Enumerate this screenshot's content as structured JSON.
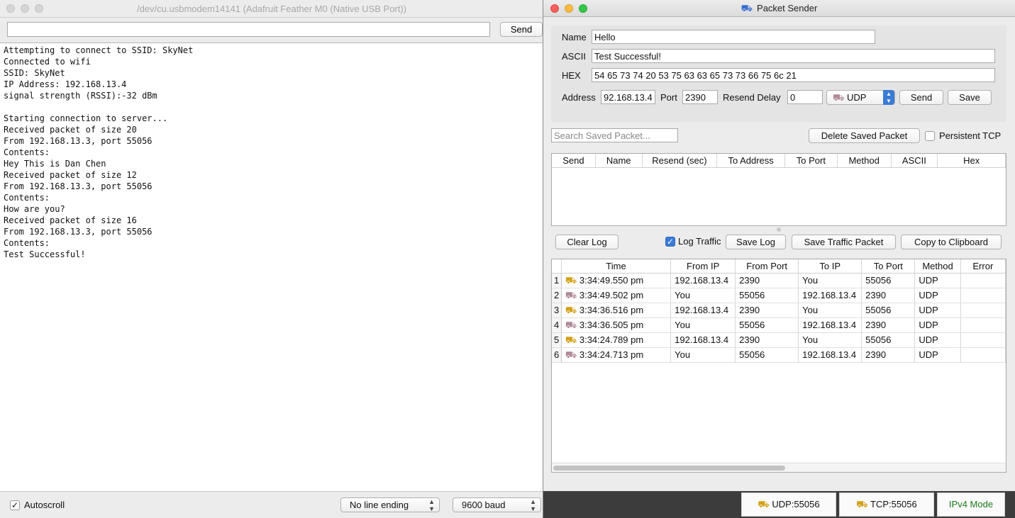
{
  "serial_monitor": {
    "title": "/dev/cu.usbmodem14141 (Adafruit Feather M0 (Native USB Port))",
    "input_value": "",
    "send_label": "Send",
    "output_lines": [
      "Attempting to connect to SSID: SkyNet",
      "Connected to wifi",
      "SSID: SkyNet",
      "IP Address: 192.168.13.4",
      "signal strength (RSSI):-32 dBm",
      "",
      "Starting connection to server...",
      "Received packet of size 20",
      "From 192.168.13.3, port 55056",
      "Contents:",
      "Hey This is Dan Chen",
      "Received packet of size 12",
      "From 192.168.13.3, port 55056",
      "Contents:",
      "How are you?",
      "Received packet of size 16",
      "From 192.168.13.3, port 55056",
      "Contents:",
      "Test Successful!"
    ],
    "autoscroll_label": "Autoscroll",
    "autoscroll_checked": "✓",
    "line_ending": "No line ending",
    "baud": "9600 baud"
  },
  "packet_sender": {
    "title": "Packet Sender",
    "name_label": "Name",
    "name_value": "Hello",
    "ascii_label": "ASCII",
    "ascii_value": "Test Successful!",
    "hex_label": "HEX",
    "hex_value": "54 65 73 74 20 53 75 63 63 65 73 73 66 75 6c 21",
    "address_label": "Address",
    "address_value": "92.168.13.4",
    "port_label": "Port",
    "port_value": "2390",
    "resend_label": "Resend Delay",
    "resend_value": "0",
    "method_value": "UDP",
    "send_label": "Send",
    "save_label": "Save",
    "search_placeholder": "Search Saved Packet...",
    "delete_saved_label": "Delete Saved Packet",
    "persistent_tcp_label": "Persistent TCP",
    "saved_columns": [
      "Send",
      "Name",
      "Resend (sec)",
      "To Address",
      "To Port",
      "Method",
      "ASCII",
      "Hex"
    ],
    "clear_log_label": "Clear Log",
    "log_traffic_label": "Log Traffic",
    "log_traffic_checked": "✓",
    "save_log_label": "Save Log",
    "save_traffic_packet_label": "Save Traffic Packet",
    "copy_clipboard_label": "Copy to Clipboard",
    "log_columns": [
      "Time",
      "From IP",
      "From Port",
      "To IP",
      "To Port",
      "Method",
      "Error"
    ],
    "log_rows": [
      {
        "n": "1",
        "dir": "in",
        "time": "3:34:49.550 pm",
        "from_ip": "192.168.13.4",
        "from_port": "2390",
        "to_ip": "You",
        "to_port": "55056",
        "method": "UDP",
        "error": ""
      },
      {
        "n": "2",
        "dir": "out",
        "time": "3:34:49.502 pm",
        "from_ip": "You",
        "from_port": "55056",
        "to_ip": "192.168.13.4",
        "to_port": "2390",
        "method": "UDP",
        "error": ""
      },
      {
        "n": "3",
        "dir": "in",
        "time": "3:34:36.516 pm",
        "from_ip": "192.168.13.4",
        "from_port": "2390",
        "to_ip": "You",
        "to_port": "55056",
        "method": "UDP",
        "error": ""
      },
      {
        "n": "4",
        "dir": "out",
        "time": "3:34:36.505 pm",
        "from_ip": "You",
        "from_port": "55056",
        "to_ip": "192.168.13.4",
        "to_port": "2390",
        "method": "UDP",
        "error": ""
      },
      {
        "n": "5",
        "dir": "in",
        "time": "3:34:24.789 pm",
        "from_ip": "192.168.13.4",
        "from_port": "2390",
        "to_ip": "You",
        "to_port": "55056",
        "method": "UDP",
        "error": ""
      },
      {
        "n": "6",
        "dir": "out",
        "time": "3:34:24.713 pm",
        "from_ip": "You",
        "from_port": "55056",
        "to_ip": "192.168.13.4",
        "to_port": "2390",
        "method": "UDP",
        "error": ""
      }
    ],
    "status_udp": "UDP:55056",
    "status_tcp": "TCP:55056",
    "status_mode": "IPv4 Mode",
    "colors": {
      "mode_text": "#1a7a1a",
      "accent": "#3a7bd5"
    }
  }
}
